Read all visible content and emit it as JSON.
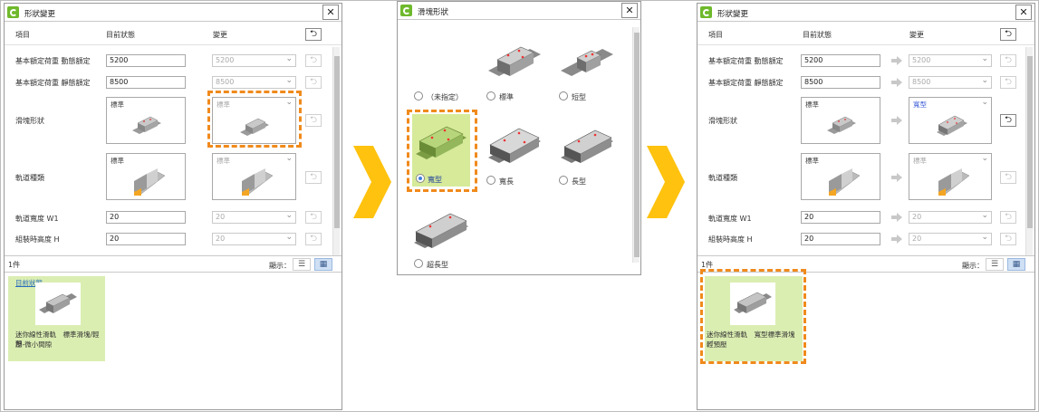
{
  "close_glyph": "✕",
  "back_glyph": "⮌",
  "colors": {
    "accent_green": "#6fb92c",
    "highlight_dash": "#f08a1c",
    "card_bg": "#dbeeb2",
    "selected_blue": "#3b5bd9",
    "arrow_yellow": "#ffc20e"
  },
  "panel_left": {
    "title": "形狀變更",
    "header": {
      "item": "項目",
      "current": "目前狀態",
      "change": "變更"
    },
    "rows": [
      {
        "label": "基本額定荷重 動態額定",
        "current": "5200",
        "change": "5200"
      },
      {
        "label": "基本額定荷重 靜態額定",
        "current": "8500",
        "change": "8500"
      },
      {
        "label": "滑塊形狀",
        "current": "標準",
        "change": "標準"
      },
      {
        "label": "軌道種類",
        "current": "標準",
        "change": "標準"
      },
      {
        "label": "軌道寬度 W1",
        "current": "20",
        "change": "20"
      },
      {
        "label": "組裝時高度 H",
        "current": "20",
        "change": "20"
      }
    ],
    "count": "1件",
    "display_label": "顯示：",
    "card": {
      "link": "目前狀態",
      "line1": "迷你線性滑軌　標準滑塊/輕預",
      "line2": "壓-微小間隙"
    }
  },
  "panel_mid": {
    "title": "滑塊形狀",
    "options": [
      {
        "label": "（未指定）"
      },
      {
        "label": "標準"
      },
      {
        "label": "短型"
      },
      {
        "label": "寬型"
      },
      {
        "label": "寬長"
      },
      {
        "label": "長型"
      },
      {
        "label": "超長型"
      }
    ]
  },
  "panel_right": {
    "title": "形狀變更",
    "header": {
      "item": "項目",
      "current": "目前狀態",
      "change": "變更"
    },
    "rows": [
      {
        "label": "基本額定荷重 動態額定",
        "current": "5200",
        "change": "5200"
      },
      {
        "label": "基本額定荷重 靜態額定",
        "current": "8500",
        "change": "8500"
      },
      {
        "label": "滑塊形狀",
        "current": "標準",
        "change": "寬型"
      },
      {
        "label": "軌道種類",
        "current": "標準",
        "change": "標準"
      },
      {
        "label": "軌道寬度 W1",
        "current": "20",
        "change": "20"
      },
      {
        "label": "組裝時高度 H",
        "current": "20",
        "change": "20"
      }
    ],
    "count": "1件",
    "display_label": "顯示：",
    "card": {
      "line1": "迷你線性滑軌　寬型標準滑塊／",
      "line2": "輕預壓"
    }
  }
}
